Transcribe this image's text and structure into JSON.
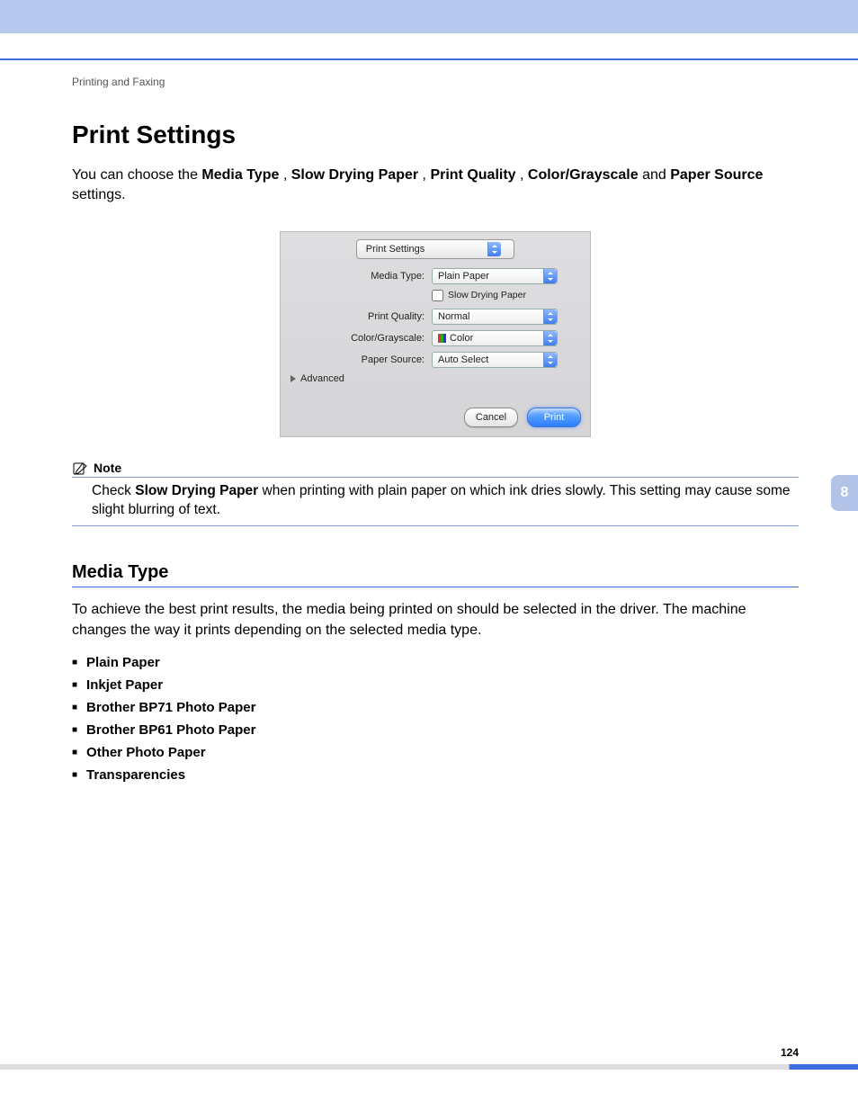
{
  "header": {
    "sectionLabel": "Printing and Faxing"
  },
  "title": "Print Settings",
  "intro": {
    "t1": "You can choose the ",
    "b1": "Media Type",
    "s1": ", ",
    "b2": "Slow Drying Paper",
    "s2": ", ",
    "b3": "Print Quality",
    "s3": ", ",
    "b4": "Color/Grayscale",
    "s4": " and ",
    "b5": "Paper Source",
    "t2": " settings."
  },
  "dialog": {
    "tabLabel": "Print Settings",
    "fields": {
      "mediaType": {
        "label": "Media Type:",
        "value": "Plain Paper"
      },
      "slowDry": {
        "label": "Slow Drying Paper"
      },
      "printQuality": {
        "label": "Print Quality:",
        "value": "Normal"
      },
      "colorGray": {
        "label": "Color/Grayscale:",
        "value": "Color"
      },
      "paperSource": {
        "label": "Paper Source:",
        "value": "Auto Select"
      }
    },
    "advanced": "Advanced",
    "buttons": {
      "cancel": "Cancel",
      "print": "Print"
    }
  },
  "note": {
    "heading": "Note",
    "t1": "Check ",
    "b1": "Slow Drying Paper",
    "t2": " when printing with plain paper on which ink dries slowly. This setting may cause some slight blurring of text."
  },
  "section2": {
    "heading": "Media Type",
    "body": "To achieve the best print results, the media being printed on should be selected in the driver. The machine changes the way it prints depending on the selected media type.",
    "items": [
      "Plain Paper",
      "Inkjet Paper",
      "Brother BP71 Photo Paper",
      "Brother BP61 Photo Paper",
      "Other Photo Paper",
      "Transparencies"
    ]
  },
  "sideTab": "8",
  "pageNumber": "124"
}
